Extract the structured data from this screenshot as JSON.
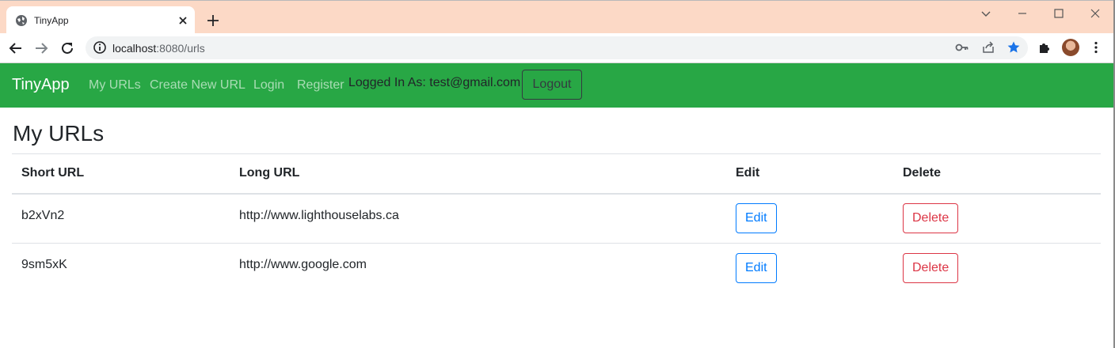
{
  "browser": {
    "tab_title": "TinyApp",
    "url_host": "localhost",
    "url_rest": ":8080/urls"
  },
  "navbar": {
    "brand": "TinyApp",
    "links": [
      "My URLs",
      "Create New URL",
      "Login",
      "Register"
    ],
    "logged_in_text": "Logged In As: test@gmail.com",
    "logout_label": "Logout",
    "bg_color": "#28a745"
  },
  "main": {
    "title": "My URLs",
    "table": {
      "headers": [
        "Short URL",
        "Long URL",
        "Edit",
        "Delete"
      ],
      "rows": [
        {
          "short": "b2xVn2",
          "long": "http://www.lighthouselabs.ca",
          "edit": "Edit",
          "delete": "Delete"
        },
        {
          "short": "9sm5xK",
          "long": "http://www.google.com",
          "edit": "Edit",
          "delete": "Delete"
        }
      ]
    }
  },
  "icons": [
    "globe-icon",
    "close-icon",
    "plus-icon",
    "back-icon",
    "forward-icon",
    "reload-icon",
    "info-icon",
    "key-icon",
    "share-icon",
    "star-icon",
    "puzzle-icon",
    "menu-icon",
    "minimize-icon",
    "maximize-icon",
    "chevron-down-icon"
  ]
}
